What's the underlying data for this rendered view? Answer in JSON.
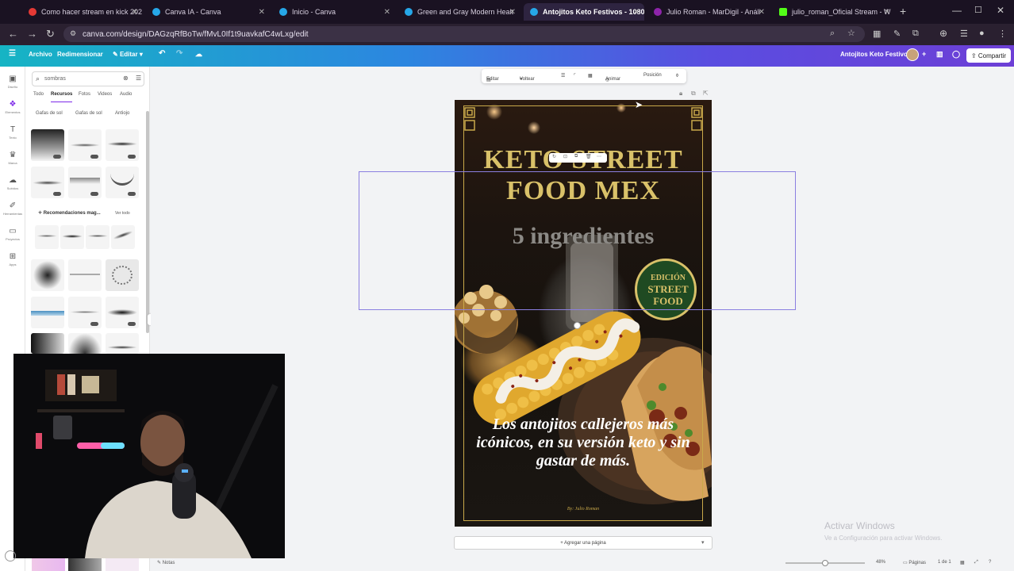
{
  "browser": {
    "tabs": [
      {
        "title": "Como hacer stream en kick 202",
        "color": "#e53935",
        "active": false
      },
      {
        "title": "Canva IA - Canva",
        "color": "#26a7e8",
        "active": false
      },
      {
        "title": "Inicio - Canva",
        "color": "#26a7e8",
        "active": false
      },
      {
        "title": "Green and Gray Modern Healt",
        "color": "#26a7e8",
        "active": false
      },
      {
        "title": "Antojitos Keto Festivos - 1080",
        "color": "#26a7e8",
        "active": true
      },
      {
        "title": "Julio Roman - MarDigil - Análi",
        "color": "#8e24aa",
        "active": false
      },
      {
        "title": "julio_roman_Oficial Stream - W",
        "color": "#53fc18",
        "active": false
      }
    ],
    "url": "canva.com/design/DAGzqRfBoTw/fMvL0If1t9uavkafC4wLxg/edit"
  },
  "canva_toolbar": {
    "file": "Archivo",
    "resize": "Redimensionar",
    "edit": "Editar",
    "design_title": "Antojitos Keto Festivos",
    "share": "Compartir"
  },
  "rail": [
    "Diseño",
    "Elementos",
    "Texto",
    "Marca",
    "Subidos",
    "Herramientas",
    "Proyectos",
    "Apps"
  ],
  "panel": {
    "search_value": "sombras",
    "tabs": [
      "Todo",
      "Recursos",
      "Fotos",
      "Videos",
      "Audio"
    ],
    "chips": [
      "Gafas de sol",
      "Gafas de sol",
      "Antiojo"
    ],
    "rec_title": "Recomendaciones mag...",
    "rec_link": "Ver todo"
  },
  "context_toolbar": {
    "filter": "Editar",
    "flip": "Voltear",
    "animate": "Animar",
    "position": "Posición"
  },
  "poster": {
    "title_line1": "KETO STREET",
    "title_line2": "FOOD MEX",
    "subtitle": "5 ingredientes",
    "badge_line1": "EDICIÓN",
    "badge_line2": "STREET",
    "badge_line3": "FOOD",
    "description": "Los antojitos callejeros más icónicos, en su versión keto y sin gastar de más.",
    "byline": "By: Julio Roman"
  },
  "canvas": {
    "add_page": "+ Agregar una página"
  },
  "status": {
    "notes": "Notas",
    "zoom": "48%",
    "pages": "Páginas",
    "page_count": "1 de 1"
  },
  "windows": {
    "activate_title": "Activar Windows",
    "activate_sub": "Ve a Configuración para activar Windows."
  }
}
